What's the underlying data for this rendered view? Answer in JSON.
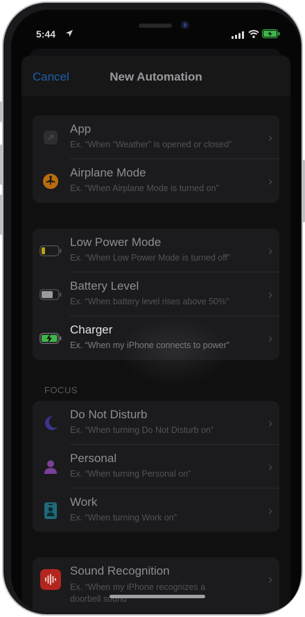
{
  "status_bar": {
    "time": "5:44"
  },
  "nav": {
    "cancel_label": "Cancel",
    "title": "New Automation"
  },
  "groups": {
    "general": [
      {
        "title": "App",
        "subtitle": "Ex. “When “Weather” is opened or closed”",
        "icon": "app-arrow-icon"
      },
      {
        "title": "Airplane Mode",
        "subtitle": "Ex. “When Airplane Mode is turned on”",
        "icon": "airplane-icon"
      }
    ],
    "power": [
      {
        "title": "Low Power Mode",
        "subtitle": "Ex. “When Low Power Mode is turned off”",
        "icon": "low-battery-icon"
      },
      {
        "title": "Battery Level",
        "subtitle": "Ex. “When battery level rises above 50%”",
        "icon": "battery-icon"
      },
      {
        "title": "Charger",
        "subtitle": "Ex. “When my iPhone connects to power”",
        "icon": "charging-battery-icon"
      }
    ],
    "focus_header": "FOCUS",
    "focus": [
      {
        "title": "Do Not Disturb",
        "subtitle": "Ex. “When turning Do Not Disturb on”",
        "icon": "moon-icon"
      },
      {
        "title": "Personal",
        "subtitle": "Ex. “When turning Personal on”",
        "icon": "person-icon"
      },
      {
        "title": "Work",
        "subtitle": "Ex. “When turning Work on”",
        "icon": "badge-icon"
      }
    ],
    "sound": [
      {
        "title": "Sound Recognition",
        "subtitle": "Ex. “When my iPhone recognizes a doorbell sound”",
        "icon": "sound-waveform-icon"
      }
    ]
  },
  "colors": {
    "accent_blue": "#1e5fa8",
    "airplane_orange": "#b86d0f",
    "low_power_yellow": "#b8a10f",
    "charging_green": "#3fb54a",
    "focus_indigo": "#3b3590",
    "personal_purple": "#7a3f98",
    "work_teal": "#1f6a78",
    "sound_red": "#b3261e"
  }
}
